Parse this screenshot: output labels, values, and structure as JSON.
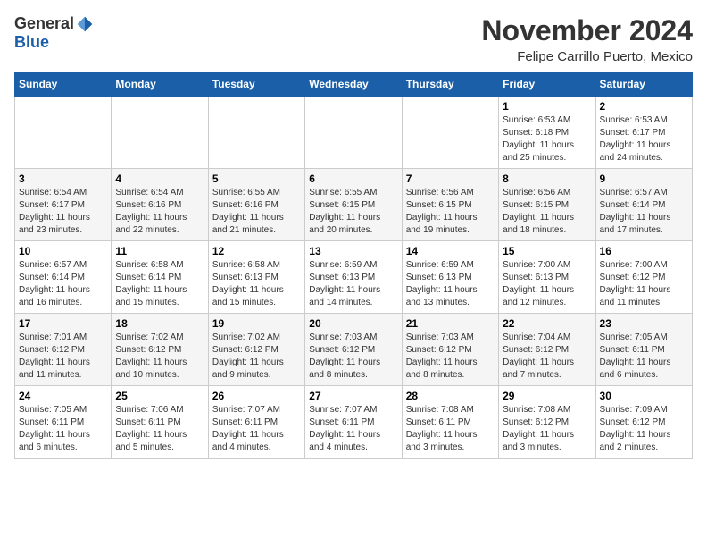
{
  "header": {
    "logo_general": "General",
    "logo_blue": "Blue",
    "month_title": "November 2024",
    "location": "Felipe Carrillo Puerto, Mexico"
  },
  "weekdays": [
    "Sunday",
    "Monday",
    "Tuesday",
    "Wednesday",
    "Thursday",
    "Friday",
    "Saturday"
  ],
  "weeks": [
    [
      {
        "day": "",
        "detail": ""
      },
      {
        "day": "",
        "detail": ""
      },
      {
        "day": "",
        "detail": ""
      },
      {
        "day": "",
        "detail": ""
      },
      {
        "day": "",
        "detail": ""
      },
      {
        "day": "1",
        "detail": "Sunrise: 6:53 AM\nSunset: 6:18 PM\nDaylight: 11 hours\nand 25 minutes."
      },
      {
        "day": "2",
        "detail": "Sunrise: 6:53 AM\nSunset: 6:17 PM\nDaylight: 11 hours\nand 24 minutes."
      }
    ],
    [
      {
        "day": "3",
        "detail": "Sunrise: 6:54 AM\nSunset: 6:17 PM\nDaylight: 11 hours\nand 23 minutes."
      },
      {
        "day": "4",
        "detail": "Sunrise: 6:54 AM\nSunset: 6:16 PM\nDaylight: 11 hours\nand 22 minutes."
      },
      {
        "day": "5",
        "detail": "Sunrise: 6:55 AM\nSunset: 6:16 PM\nDaylight: 11 hours\nand 21 minutes."
      },
      {
        "day": "6",
        "detail": "Sunrise: 6:55 AM\nSunset: 6:15 PM\nDaylight: 11 hours\nand 20 minutes."
      },
      {
        "day": "7",
        "detail": "Sunrise: 6:56 AM\nSunset: 6:15 PM\nDaylight: 11 hours\nand 19 minutes."
      },
      {
        "day": "8",
        "detail": "Sunrise: 6:56 AM\nSunset: 6:15 PM\nDaylight: 11 hours\nand 18 minutes."
      },
      {
        "day": "9",
        "detail": "Sunrise: 6:57 AM\nSunset: 6:14 PM\nDaylight: 11 hours\nand 17 minutes."
      }
    ],
    [
      {
        "day": "10",
        "detail": "Sunrise: 6:57 AM\nSunset: 6:14 PM\nDaylight: 11 hours\nand 16 minutes."
      },
      {
        "day": "11",
        "detail": "Sunrise: 6:58 AM\nSunset: 6:14 PM\nDaylight: 11 hours\nand 15 minutes."
      },
      {
        "day": "12",
        "detail": "Sunrise: 6:58 AM\nSunset: 6:13 PM\nDaylight: 11 hours\nand 15 minutes."
      },
      {
        "day": "13",
        "detail": "Sunrise: 6:59 AM\nSunset: 6:13 PM\nDaylight: 11 hours\nand 14 minutes."
      },
      {
        "day": "14",
        "detail": "Sunrise: 6:59 AM\nSunset: 6:13 PM\nDaylight: 11 hours\nand 13 minutes."
      },
      {
        "day": "15",
        "detail": "Sunrise: 7:00 AM\nSunset: 6:13 PM\nDaylight: 11 hours\nand 12 minutes."
      },
      {
        "day": "16",
        "detail": "Sunrise: 7:00 AM\nSunset: 6:12 PM\nDaylight: 11 hours\nand 11 minutes."
      }
    ],
    [
      {
        "day": "17",
        "detail": "Sunrise: 7:01 AM\nSunset: 6:12 PM\nDaylight: 11 hours\nand 11 minutes."
      },
      {
        "day": "18",
        "detail": "Sunrise: 7:02 AM\nSunset: 6:12 PM\nDaylight: 11 hours\nand 10 minutes."
      },
      {
        "day": "19",
        "detail": "Sunrise: 7:02 AM\nSunset: 6:12 PM\nDaylight: 11 hours\nand 9 minutes."
      },
      {
        "day": "20",
        "detail": "Sunrise: 7:03 AM\nSunset: 6:12 PM\nDaylight: 11 hours\nand 8 minutes."
      },
      {
        "day": "21",
        "detail": "Sunrise: 7:03 AM\nSunset: 6:12 PM\nDaylight: 11 hours\nand 8 minutes."
      },
      {
        "day": "22",
        "detail": "Sunrise: 7:04 AM\nSunset: 6:12 PM\nDaylight: 11 hours\nand 7 minutes."
      },
      {
        "day": "23",
        "detail": "Sunrise: 7:05 AM\nSunset: 6:11 PM\nDaylight: 11 hours\nand 6 minutes."
      }
    ],
    [
      {
        "day": "24",
        "detail": "Sunrise: 7:05 AM\nSunset: 6:11 PM\nDaylight: 11 hours\nand 6 minutes."
      },
      {
        "day": "25",
        "detail": "Sunrise: 7:06 AM\nSunset: 6:11 PM\nDaylight: 11 hours\nand 5 minutes."
      },
      {
        "day": "26",
        "detail": "Sunrise: 7:07 AM\nSunset: 6:11 PM\nDaylight: 11 hours\nand 4 minutes."
      },
      {
        "day": "27",
        "detail": "Sunrise: 7:07 AM\nSunset: 6:11 PM\nDaylight: 11 hours\nand 4 minutes."
      },
      {
        "day": "28",
        "detail": "Sunrise: 7:08 AM\nSunset: 6:11 PM\nDaylight: 11 hours\nand 3 minutes."
      },
      {
        "day": "29",
        "detail": "Sunrise: 7:08 AM\nSunset: 6:12 PM\nDaylight: 11 hours\nand 3 minutes."
      },
      {
        "day": "30",
        "detail": "Sunrise: 7:09 AM\nSunset: 6:12 PM\nDaylight: 11 hours\nand 2 minutes."
      }
    ]
  ]
}
